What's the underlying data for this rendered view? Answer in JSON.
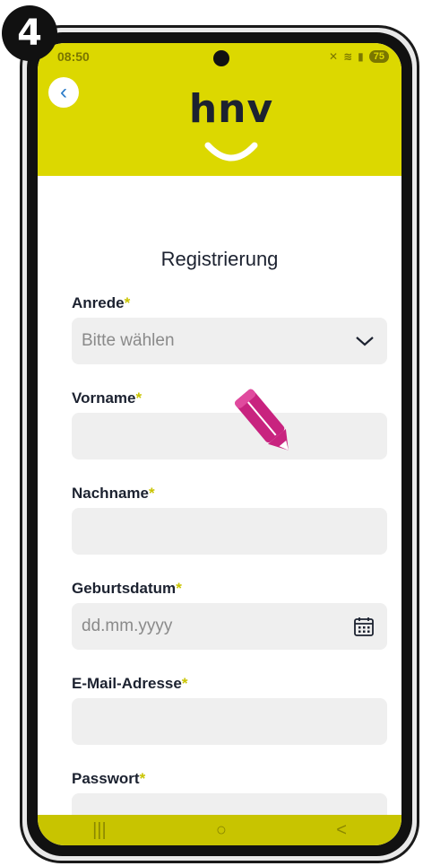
{
  "step_badge": "4",
  "status_bar": {
    "time": "08:50",
    "battery": "75"
  },
  "header": {
    "brand": "hnv",
    "accent_color": "#dcd800"
  },
  "form": {
    "title": "Registrierung",
    "required_mark": "*",
    "fields": [
      {
        "label": "Anrede",
        "value": "Bitte wählen",
        "icon": "chevron-down-icon"
      },
      {
        "label": "Vorname",
        "value": ""
      },
      {
        "label": "Nachname",
        "value": ""
      },
      {
        "label": "Geburtsdatum",
        "placeholder": "dd.mm.yyyy",
        "icon": "calendar-icon"
      },
      {
        "label": "E-Mail-Adresse",
        "value": ""
      },
      {
        "label": "Passwort",
        "value": ""
      }
    ]
  },
  "nav": {
    "recent": "|||",
    "home": "○",
    "back": "<"
  }
}
